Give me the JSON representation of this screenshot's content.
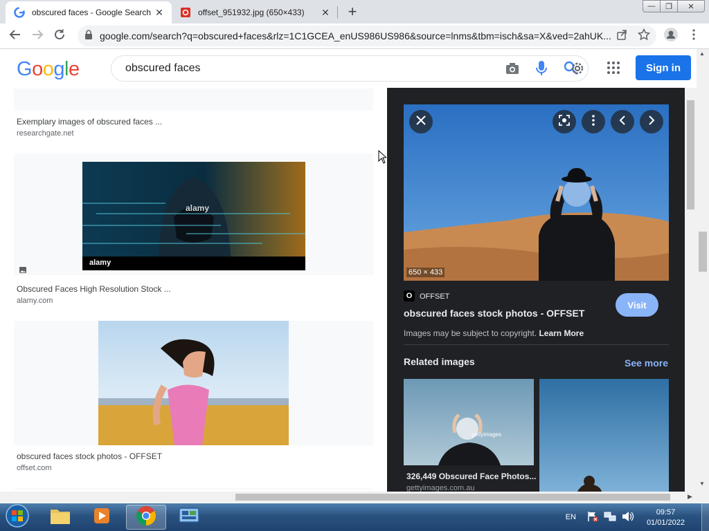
{
  "browser": {
    "tabs": [
      {
        "title": "obscured faces - Google Search",
        "close": "✕"
      },
      {
        "title": "offset_951932.jpg (650×433)",
        "close": "✕"
      }
    ],
    "new_tab": "+",
    "window_controls": [
      "—",
      "❐",
      "✕"
    ],
    "url": "google.com/search?q=obscured+faces&rlz=1C1GCEA_enUS986US986&source=lnms&tbm=isch&sa=X&ved=2ahUK..."
  },
  "google": {
    "logo_letters": [
      "G",
      "o",
      "o",
      "g",
      "l",
      "e"
    ],
    "logo_colors": [
      "#4285f4",
      "#ea4335",
      "#fbbc05",
      "#4285f4",
      "#34a853",
      "#ea4335"
    ],
    "search_query": "obscured faces",
    "signin_label": "Sign in"
  },
  "results": [
    {
      "title": "Exemplary images of obscured faces ...",
      "site": "researchgate.net"
    },
    {
      "title": "Obscured Faces High Resolution Stock ...",
      "site": "alamy.com",
      "watermark": "alamy",
      "caption": "alamy"
    },
    {
      "title": "obscured faces stock photos - OFFSET",
      "site": "offset.com"
    }
  ],
  "panel": {
    "dimensions": "650 × 433",
    "source_badge": "O",
    "source_name": "OFFSET",
    "title": "obscured faces stock photos - OFFSET",
    "visit_label": "Visit",
    "copyright_text": "Images may be subject to copyright.",
    "learn_more": "Learn More",
    "related_heading": "Related images",
    "see_more": "See more",
    "related": [
      {
        "title": "326,449 Obscured Face Photos...",
        "site": "gettyimages.com.au",
        "watermark": "gettyimages"
      }
    ]
  },
  "taskbar": {
    "language": "EN",
    "time": "09:57",
    "date": "01/01/2022"
  },
  "colors": {
    "accent": "#1a73e8",
    "panel_bg": "#202124",
    "link_blue": "#8ab4f8"
  }
}
